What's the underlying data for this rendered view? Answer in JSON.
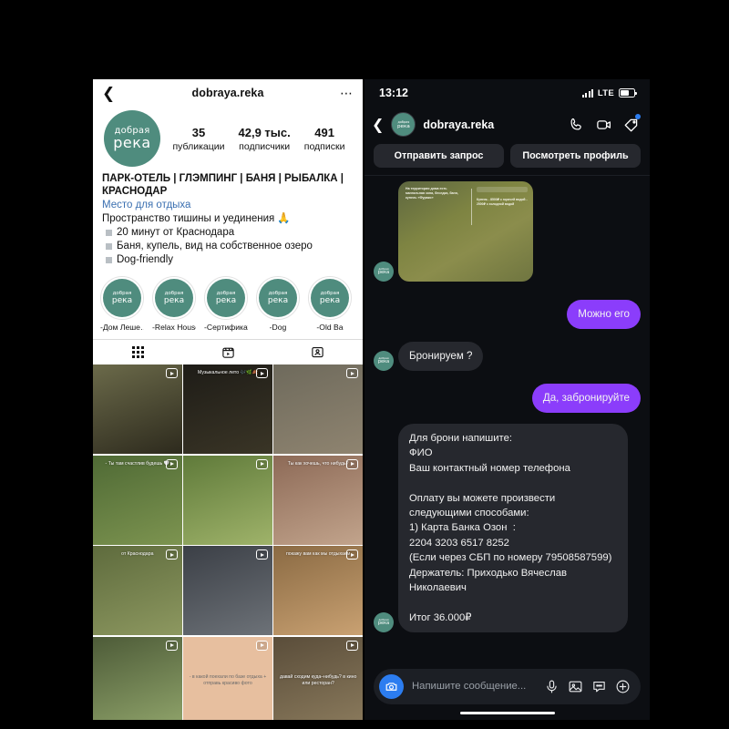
{
  "profile": {
    "back_icon": "chevron-left-icon",
    "title": "dobraya.reka",
    "more_icon": "more-options-icon",
    "avatar": {
      "line1": "добрая",
      "line2": "река"
    },
    "stats": [
      {
        "num": "35",
        "label": "публикации"
      },
      {
        "num": "42,9 тыс.",
        "label": "подписчики"
      },
      {
        "num": "491",
        "label": "подписки"
      }
    ],
    "bio": {
      "title": "ПАРК-ОТЕЛЬ | ГЛЭМПИНГ | БАНЯ | РЫБАЛКА | КРАСНОДАР",
      "category": "Место для отдыха",
      "tagline": "Пространство тишины и уединения 🙏",
      "bullets": [
        "20 минут от Краснодара",
        "Баня, купель, вид на собственное озеро",
        "Dog-friendly"
      ]
    },
    "highlights": [
      {
        "label": "-Дом Леше…"
      },
      {
        "label": "-Relax House"
      },
      {
        "label": "-Сертификат"
      },
      {
        "label": "-Dog"
      },
      {
        "label": "-Old Ba"
      }
    ],
    "tabs": [
      {
        "name": "grid-tab",
        "icon": "grid-icon"
      },
      {
        "name": "reels-tab",
        "icon": "reels-icon"
      },
      {
        "name": "tagged-tab",
        "icon": "tagged-person-icon"
      }
    ],
    "grid": [
      {
        "caption": "",
        "c1": "#6b6a4a",
        "c2": "#2d2a1d",
        "badge": "reel-icon",
        "captionDark": false
      },
      {
        "caption": "Музыкальное лето 🎶🌿🍂",
        "c1": "#1e1c17",
        "c2": "#3a3526",
        "badge": "reel-icon",
        "captionDark": false
      },
      {
        "caption": "",
        "c1": "#6e6a5c",
        "c2": "#8f8470",
        "badge": "reel-icon",
        "captionDark": false
      },
      {
        "caption": "- Ты там счастлив будешь 🤍",
        "c1": "#4f6a35",
        "c2": "#7d9450",
        "badge": "reel-icon",
        "captionDark": false
      },
      {
        "caption": "",
        "c1": "#5f7a3a",
        "c2": "#9fb36a",
        "badge": "reel-icon",
        "captionDark": false
      },
      {
        "caption": "Ты как хочешь, что нибудь?",
        "c1": "#8d6a57",
        "c2": "#c2a48c",
        "badge": "reel-icon",
        "captionDark": false
      },
      {
        "caption": "от Краснодара",
        "c1": "#5e6b3d",
        "c2": "#8d9860",
        "badge": "reel-icon",
        "captionDark": false
      },
      {
        "caption": "",
        "c1": "#3b3f46",
        "c2": "#6d7278",
        "badge": "reel-icon",
        "captionDark": false
      },
      {
        "caption": "покажу вам как мы отдыхаем",
        "c1": "#8a6a43",
        "c2": "#c9a172",
        "badge": "reel-icon",
        "captionDark": false
      },
      {
        "caption": "",
        "c1": "#4d5b38",
        "c2": "#8fa36a",
        "badge": "reel-icon",
        "captionDark": false
      },
      {
        "caption": "- в какой поехали по базе отдыха + отправь красиво фото",
        "c1": "#e7bf9f",
        "c2": "#e7bf9f",
        "badge": "reel-icon",
        "captionDark": true
      },
      {
        "caption": "давай сходим куда–нибудь? в кино или ресторан?",
        "c1": "#5a4d3a",
        "c2": "#8a7a5c",
        "badge": "reel-icon",
        "captionDark": false
      }
    ]
  },
  "chat": {
    "status": {
      "time": "13:12",
      "network": "LTE",
      "signal_icon": "signal-bars-icon",
      "battery_icon": "battery-icon"
    },
    "header": {
      "back_icon": "chevron-left-icon",
      "name": "dobraya.reka",
      "avatar": {
        "line1": "добрая",
        "line2": "река"
      },
      "call_icon": "phone-icon",
      "video_icon": "video-camera-icon",
      "tag_icon": "tag-icon"
    },
    "actions": [
      {
        "label": "Отправить запрос"
      },
      {
        "label": "Посмотреть профиль"
      }
    ],
    "messages": [
      {
        "side": "in",
        "type": "image",
        "image_text_left": "На территории дома есть мангальная зона, беседка, баня, купель «Фурако»",
        "image_text_right": "Купель\n- 8500₽ с горячей водой\n- 2500₽ с холодной водой"
      },
      {
        "side": "out",
        "type": "text",
        "text": "Можно его"
      },
      {
        "side": "in",
        "type": "text",
        "text": "Бронируем ?"
      },
      {
        "side": "out",
        "type": "text",
        "text": "Да, забронируйте"
      },
      {
        "side": "in",
        "type": "text",
        "text": "Для брони напишите:\nФИО\nВаш контактный номер телефона\n\nОплату вы можете произвести следующими способами:\n1) Карта Банка Озон  :\n2204 3203 6517 8252\n(Если через СБП по номеру 79508587599)\nДержатель: Приходько Вячеслав Николаевич\n\nИтог 36.000₽"
      }
    ],
    "input": {
      "camera_icon": "camera-icon",
      "placeholder": "Напишите сообщение...",
      "mic_icon": "microphone-icon",
      "gallery_icon": "gallery-image-icon",
      "sticker_icon": "sticker-icon",
      "plus_icon": "plus-circle-icon"
    }
  },
  "colors": {
    "brand_teal": "#4f8c7e",
    "bubble_purple": "#8b3dfb",
    "bubble_gray": "#26282e",
    "accent_blue": "#2c7df0",
    "link_blue": "#3a6fb0"
  }
}
